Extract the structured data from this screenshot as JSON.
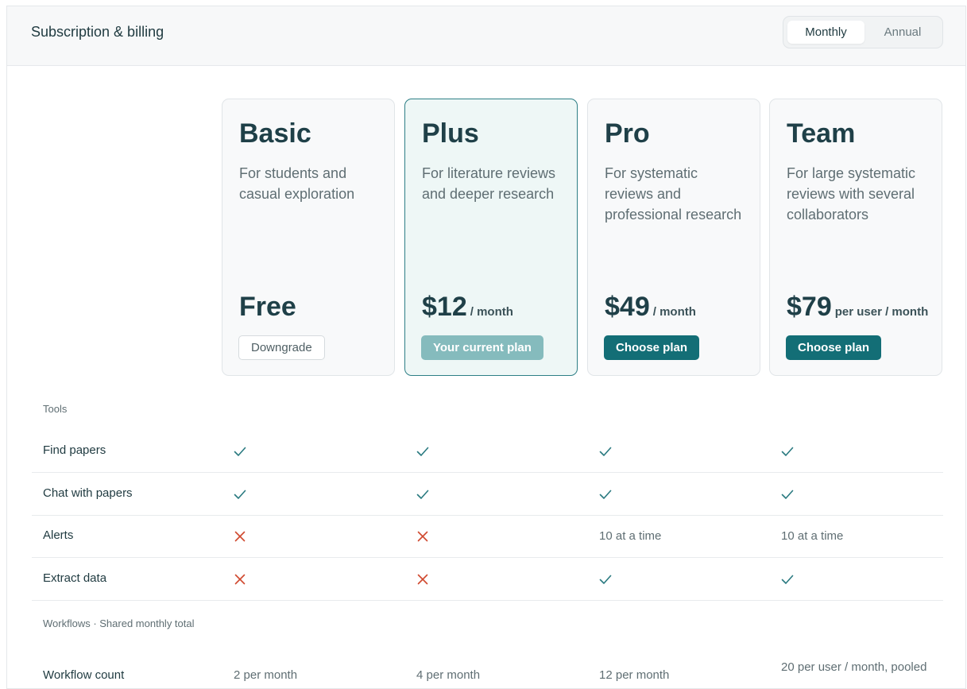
{
  "header": {
    "title": "Subscription & billing"
  },
  "billing_toggle": {
    "monthly": "Monthly",
    "annual": "Annual",
    "selected": "Monthly"
  },
  "plans": [
    {
      "name": "Basic",
      "description": "For students and casual exploration",
      "price": "Free",
      "period": "",
      "button": "Downgrade"
    },
    {
      "name": "Plus",
      "description": "For literature reviews and deeper research",
      "price": "$12",
      "period": "/ month",
      "button": "Your current plan"
    },
    {
      "name": "Pro",
      "description": "For systematic reviews and professional research",
      "price": "$49",
      "period": "/ month",
      "button": "Choose plan"
    },
    {
      "name": "Team",
      "description": "For large systematic reviews with several collaborators",
      "price": "$79",
      "period": "per user / month",
      "button": "Choose plan"
    }
  ],
  "sections": {
    "tools": "Tools",
    "workflows": "Workflows · Shared monthly total"
  },
  "features": [
    {
      "label": "Find papers",
      "values": [
        "check",
        "check",
        "check",
        "check"
      ]
    },
    {
      "label": "Chat with papers",
      "values": [
        "check",
        "check",
        "check",
        "check"
      ]
    },
    {
      "label": "Alerts",
      "values": [
        "cross",
        "cross",
        "10 at a time",
        "10 at a time"
      ]
    },
    {
      "label": "Extract data",
      "values": [
        "cross",
        "cross",
        "check",
        "check"
      ]
    }
  ],
  "workflow_rows": [
    {
      "label": "Workflow count",
      "values": [
        "2 per month",
        "4 per month",
        "12 per month",
        "20 per user / month, pooled"
      ]
    }
  ],
  "colors": {
    "accent": "#136e76",
    "check": "#2a7a80",
    "cross": "#d0492f"
  }
}
